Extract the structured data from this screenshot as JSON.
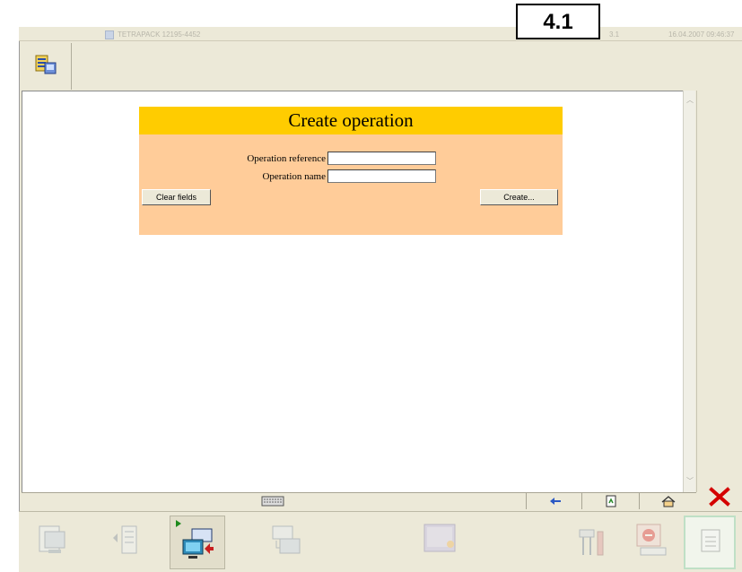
{
  "titlebar": {
    "app_title": "TETRAPACK 12195-4452",
    "version_label": "4.1",
    "page_number": "3.1",
    "datetime": "16.04.2007 09:46:37"
  },
  "form": {
    "title": "Create operation",
    "operation_reference_label": "Operation reference",
    "operation_reference_value": "",
    "operation_name_label": "Operation name",
    "operation_name_value": "",
    "clear_button": "Clear fields",
    "create_button": "Create..."
  },
  "statusbar": {
    "keyboard_icon": "keyboard-icon",
    "back_icon": "back-arrow-icon",
    "refresh_icon": "refresh-icon",
    "home_icon": "home-icon",
    "close_icon": "close-x-icon"
  },
  "taskbar": {
    "items": [
      {
        "icon": "report-screen-icon",
        "enabled": false
      },
      {
        "icon": "list-navigation-icon",
        "enabled": false
      },
      {
        "icon": "operation-transfer-icon",
        "enabled": true,
        "active": true
      },
      {
        "icon": "data-transfer-icon",
        "enabled": false
      },
      {
        "icon": "display-screen-icon",
        "enabled": false
      },
      {
        "icon": "tools-icon",
        "enabled": false
      },
      {
        "icon": "stop-screen-icon",
        "enabled": false
      },
      {
        "icon": "document-icon",
        "enabled": true,
        "highlighted": true
      }
    ]
  },
  "colors": {
    "form_header": "#ffcc00",
    "form_body": "#ffcc99",
    "chrome": "#ece9d8",
    "close_red": "#d40000"
  }
}
